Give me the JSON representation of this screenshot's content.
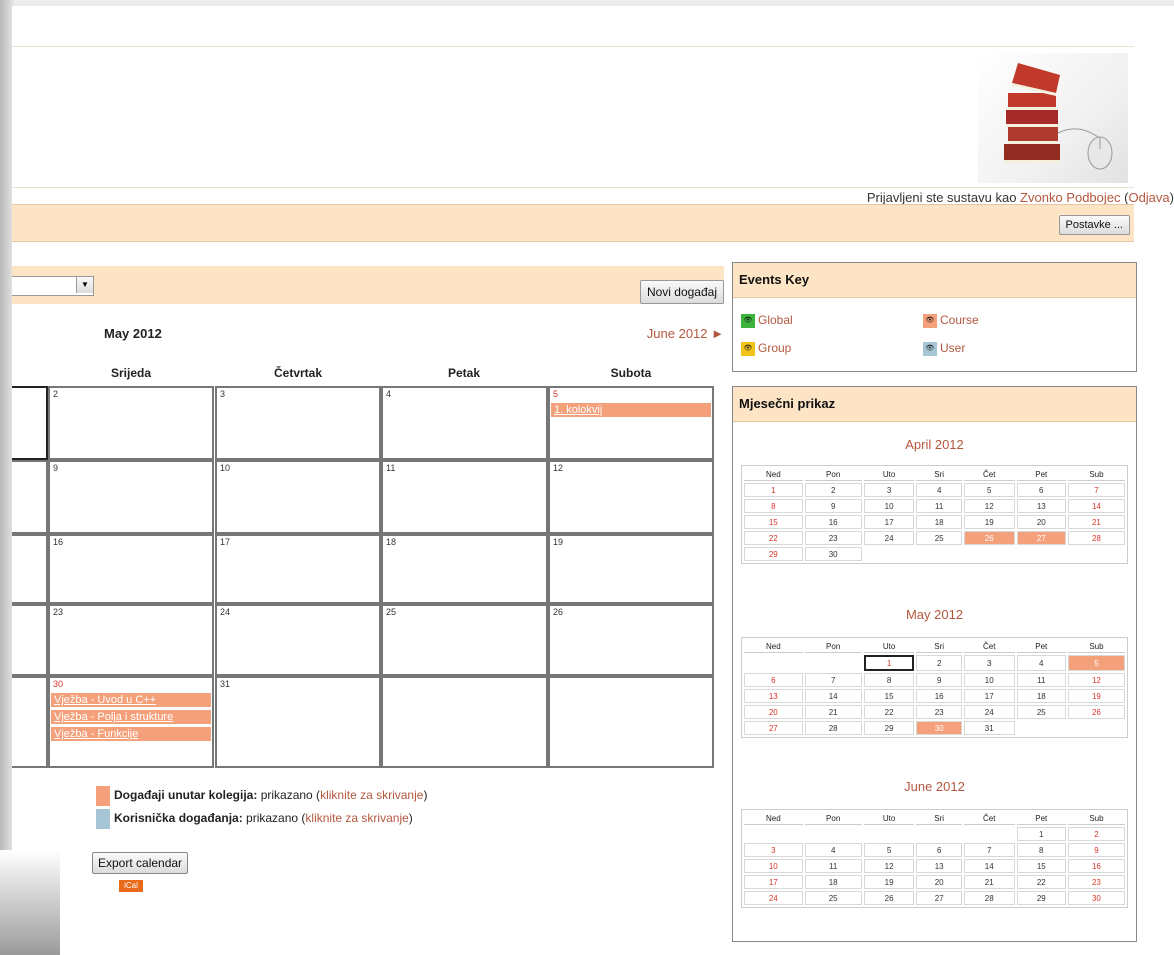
{
  "header": {
    "login_prefix": "Prijavljeni ste sustavu kao ",
    "user_name": "Zvonko Podbojec",
    "logout_open": " (",
    "logout": "Odjava",
    "logout_close": ")",
    "settings_button": "Postavke ..."
  },
  "calendar": {
    "new_event_button": "Novi događaj",
    "month_title": "May 2012",
    "next_month": "June 2012 ►",
    "day_headers": [
      "Srijeda",
      "Četvrtak",
      "Petak",
      "Subota"
    ],
    "rows": [
      [
        {
          "day": "2"
        },
        {
          "day": "3"
        },
        {
          "day": "4"
        },
        {
          "day": "5",
          "events": [
            "1. kolokvij"
          ]
        }
      ],
      [
        {
          "day": "9"
        },
        {
          "day": "10"
        },
        {
          "day": "11"
        },
        {
          "day": "12"
        }
      ],
      [
        {
          "day": "16"
        },
        {
          "day": "17"
        },
        {
          "day": "18"
        },
        {
          "day": "19"
        }
      ],
      [
        {
          "day": "23"
        },
        {
          "day": "24"
        },
        {
          "day": "25"
        },
        {
          "day": "26"
        }
      ],
      [
        {
          "day": "30",
          "events": [
            "Vježba - Uvod u C++",
            "Vježba - Polja i strukture",
            "Vježba - Funkcije"
          ]
        },
        {
          "day": "31"
        },
        {
          "day": ""
        },
        {
          "day": ""
        }
      ]
    ],
    "legend": {
      "course_label": "Događaji unutar kolegija:",
      "course_state": " prikazano (",
      "course_link": "kliknite za skrivanje",
      "course_close": ")",
      "user_label": "Korisnička događanja:",
      "user_state": " prikazano (",
      "user_link": "kliknite za skrivanje",
      "user_close": ")"
    },
    "export_button": "Export calendar",
    "ical": "iCal"
  },
  "events_key": {
    "title": "Events Key",
    "items": {
      "global": "Global",
      "course": "Course",
      "group": "Group",
      "user": "User"
    }
  },
  "monthly_view": {
    "title": "Mjesečni prikaz",
    "day_names": [
      "Ned",
      "Pon",
      "Uto",
      "Sri",
      "Čet",
      "Pet",
      "Sub"
    ],
    "months": [
      {
        "name": "April 2012",
        "weeks": [
          [
            "1",
            "2",
            "3",
            "4",
            "5",
            "6",
            "7"
          ],
          [
            "8",
            "9",
            "10",
            "11",
            "12",
            "13",
            "14"
          ],
          [
            "15",
            "16",
            "17",
            "18",
            "19",
            "20",
            "21"
          ],
          [
            "22",
            "23",
            "24",
            "25",
            "26",
            "27",
            "28"
          ],
          [
            "29",
            "30",
            "",
            "",
            "",
            "",
            ""
          ]
        ],
        "events": [
          "26",
          "27"
        ],
        "today": ""
      },
      {
        "name": "May 2012",
        "weeks": [
          [
            "",
            "",
            "1",
            "2",
            "3",
            "4",
            "5"
          ],
          [
            "6",
            "7",
            "8",
            "9",
            "10",
            "11",
            "12"
          ],
          [
            "13",
            "14",
            "15",
            "16",
            "17",
            "18",
            "19"
          ],
          [
            "20",
            "21",
            "22",
            "23",
            "24",
            "25",
            "26"
          ],
          [
            "27",
            "28",
            "29",
            "30",
            "31",
            "",
            ""
          ]
        ],
        "events": [
          "5",
          "30"
        ],
        "today": "1"
      },
      {
        "name": "June 2012",
        "weeks": [
          [
            "",
            "",
            "",
            "",
            "",
            "1",
            "2"
          ],
          [
            "3",
            "4",
            "5",
            "6",
            "7",
            "8",
            "9"
          ],
          [
            "10",
            "11",
            "12",
            "13",
            "14",
            "15",
            "16"
          ],
          [
            "17",
            "18",
            "19",
            "20",
            "21",
            "22",
            "23"
          ],
          [
            "24",
            "25",
            "26",
            "27",
            "28",
            "29",
            "30"
          ]
        ],
        "events": [],
        "today": ""
      }
    ]
  },
  "colors": {
    "course": "#f4a07a",
    "user": "#a6c6d6",
    "global": "#3cb43c",
    "group": "#f2c31a",
    "accent_link": "#b4573f",
    "header_band": "#fde4c4"
  }
}
